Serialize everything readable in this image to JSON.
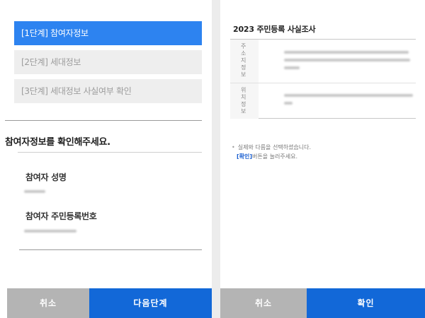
{
  "left": {
    "steps": [
      {
        "label": "[1단계] 참여자정보",
        "active": true
      },
      {
        "label": "[2단계] 세대정보",
        "active": false
      },
      {
        "label": "[3단계] 세대정보 사실여부 확인",
        "active": false
      }
    ],
    "section_title": "참여자정보를 확인해주세요.",
    "fields": [
      {
        "label": "참여자 성명"
      },
      {
        "label": "참여자 주민등록번호"
      }
    ],
    "buttons": {
      "cancel": "취소",
      "next": "다음단계"
    }
  },
  "right": {
    "title": "2023 주민등록 사실조사",
    "rows": [
      {
        "header": "주소지정보"
      },
      {
        "header": "위치정보"
      }
    ],
    "notice": {
      "line1": "실제와 다름을 선택하셨습니다.",
      "link": "[확인]",
      "line2_rest": "버튼을 눌러주세요."
    },
    "buttons": {
      "cancel": "취소",
      "confirm": "확인"
    }
  },
  "colors": {
    "accent_blue": "#2d83f0",
    "button_blue": "#1268d8",
    "button_gray": "#b4b4b4",
    "link_blue": "#1a5fd0"
  }
}
